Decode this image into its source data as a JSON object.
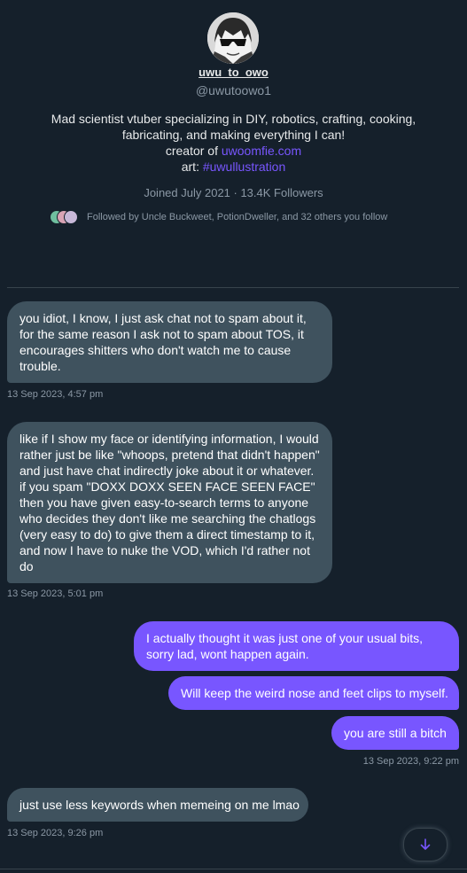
{
  "profile": {
    "display_name": "uwu_to_owo",
    "handle": "@uwutoowo1",
    "bio_line1": "Mad scientist vtuber specializing in DIY, robotics, crafting, cooking,",
    "bio_line2": "fabricating, and making everything I can!",
    "creator_prefix": "creator of ",
    "creator_link": "uwoomfie.com",
    "art_prefix": "art: ",
    "art_hashtag": "#uwullustration",
    "joined_followers": "Joined July 2021 · 13.4K Followers",
    "followed_by": "Followed by Uncle Buckweet, PotionDweller, and 32 others you follow"
  },
  "messages": [
    {
      "direction": "received",
      "text": "you idiot, I know, I just ask chat not to spam about it, for the same reason I ask not to spam about TOS, it encourages shitters who don't watch me to cause trouble.",
      "timestamp": "13 Sep 2023, 4:57 pm"
    },
    {
      "direction": "received",
      "text": "like if I show my face or identifying information, I would rather just be like \"whoops, pretend that didn't happen\" and just have chat indirectly joke about it or whatever. if you spam \"DOXX DOXX SEEN FACE SEEN FACE\" then you have given easy-to-search terms to anyone who decides they don't like me searching the chatlogs (very easy to do) to give them a direct timestamp to it, and now I have to nuke the VOD, which I'd rather not do",
      "timestamp": "13 Sep 2023, 5:01 pm"
    },
    {
      "direction": "sent",
      "text": "I actually thought it was just one of your usual bits, sorry lad, wont happen again."
    },
    {
      "direction": "sent",
      "text": "Will keep the weird nose and feet clips to myself."
    },
    {
      "direction": "sent",
      "text": "you are still a bitch",
      "timestamp": "13 Sep 2023, 9:22 pm"
    },
    {
      "direction": "received",
      "text": "just use less keywords when memeing on me lmao",
      "timestamp": "13 Sep 2023, 9:26 pm"
    }
  ],
  "icons": {
    "scroll_down": "arrow-down-icon",
    "avatar": "sunglasses-avatar"
  },
  "colors": {
    "background": "#15202b",
    "received_bubble": "#3f525e",
    "sent_bubble": "#7856ff",
    "link": "#7856ff",
    "muted_text": "#8b98a5",
    "divider": "#38444d"
  }
}
